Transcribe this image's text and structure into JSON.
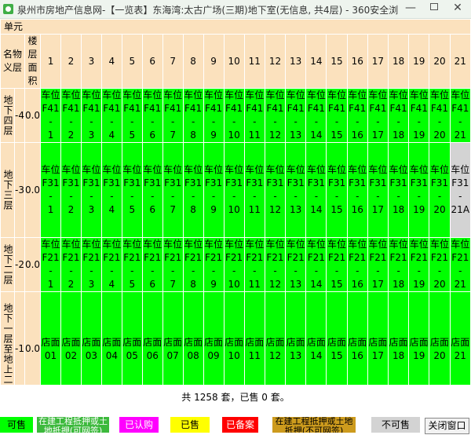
{
  "window": {
    "title": "泉州市房地产信息网-【一览表】东海湾:太古广场(三期)地下室(无信息, 共4层) - 360安全浏",
    "minimize": "—",
    "close": "✕"
  },
  "table": {
    "unit_label": "单元",
    "name_header": "名物义层",
    "area_header": "楼层面积",
    "columns": [
      "1",
      "2",
      "3",
      "4",
      "5",
      "6",
      "7",
      "8",
      "9",
      "10",
      "11",
      "12",
      "13",
      "14",
      "15",
      "16",
      "17",
      "18",
      "19",
      "20",
      "21"
    ],
    "floors": [
      {
        "name": "地下四层",
        "floor": "-4",
        "area": "0.0",
        "cells": [
          {
            "prefix": "车位",
            "code": "F41-",
            "num": "1"
          },
          {
            "prefix": "车位",
            "code": "F41-",
            "num": "2"
          },
          {
            "prefix": "车位",
            "code": "F41-",
            "num": "3"
          },
          {
            "prefix": "车位",
            "code": "F41-",
            "num": "4"
          },
          {
            "prefix": "车位",
            "code": "F41-",
            "num": "5"
          },
          {
            "prefix": "车位",
            "code": "F41-",
            "num": "6"
          },
          {
            "prefix": "车位",
            "code": "F41-",
            "num": "7"
          },
          {
            "prefix": "车位",
            "code": "F41-",
            "num": "8"
          },
          {
            "prefix": "车位",
            "code": "F41-",
            "num": "9"
          },
          {
            "prefix": "车位",
            "code": "F41-",
            "num": "10"
          },
          {
            "prefix": "车位",
            "code": "F41-",
            "num": "11"
          },
          {
            "prefix": "车位",
            "code": "F41-",
            "num": "12"
          },
          {
            "prefix": "车位",
            "code": "F41-",
            "num": "13"
          },
          {
            "prefix": "车位",
            "code": "F41-",
            "num": "14"
          },
          {
            "prefix": "车位",
            "code": "F41-",
            "num": "15"
          },
          {
            "prefix": "车位",
            "code": "F41-",
            "num": "16"
          },
          {
            "prefix": "车位",
            "code": "F41-",
            "num": "17"
          },
          {
            "prefix": "车位",
            "code": "F41-",
            "num": "18"
          },
          {
            "prefix": "车位",
            "code": "F41-",
            "num": "19"
          },
          {
            "prefix": "车位",
            "code": "F41-",
            "num": "20"
          },
          {
            "prefix": "车位",
            "code": "F41-",
            "num": "21"
          }
        ]
      },
      {
        "name": "地下三层",
        "floor": "-3",
        "area": "0.0",
        "cells": [
          {
            "prefix": "车位",
            "code": "F31-",
            "num": "1"
          },
          {
            "prefix": "车位",
            "code": "F31-",
            "num": "2"
          },
          {
            "prefix": "车位",
            "code": "F31-",
            "num": "3"
          },
          {
            "prefix": "车位",
            "code": "F31-",
            "num": "4"
          },
          {
            "prefix": "车位",
            "code": "F31-",
            "num": "5"
          },
          {
            "prefix": "车位",
            "code": "F31-",
            "num": "6"
          },
          {
            "prefix": "车位",
            "code": "F31-",
            "num": "7"
          },
          {
            "prefix": "车位",
            "code": "F31-",
            "num": "8"
          },
          {
            "prefix": "车位",
            "code": "F31-",
            "num": "9"
          },
          {
            "prefix": "车位",
            "code": "F31-",
            "num": "10"
          },
          {
            "prefix": "车位",
            "code": "F31-",
            "num": "11"
          },
          {
            "prefix": "车位",
            "code": "F31-",
            "num": "12"
          },
          {
            "prefix": "车位",
            "code": "F31-",
            "num": "13"
          },
          {
            "prefix": "车位",
            "code": "F31-",
            "num": "14"
          },
          {
            "prefix": "车位",
            "code": "F31-",
            "num": "15"
          },
          {
            "prefix": "车位",
            "code": "F31-",
            "num": "16"
          },
          {
            "prefix": "车位",
            "code": "F31-",
            "num": "17"
          },
          {
            "prefix": "车位",
            "code": "F31-",
            "num": "18"
          },
          {
            "prefix": "车位",
            "code": "F31-",
            "num": "19"
          },
          {
            "prefix": "车位",
            "code": "F31-",
            "num": "20"
          },
          {
            "prefix": "车位",
            "code": "F31-",
            "num": "21A",
            "gray": true
          }
        ]
      },
      {
        "name": "地下二层",
        "floor": "-2",
        "area": "0.0",
        "cells": [
          {
            "prefix": "车位",
            "code": "F21-",
            "num": "1"
          },
          {
            "prefix": "车位",
            "code": "F21-",
            "num": "2"
          },
          {
            "prefix": "车位",
            "code": "F21-",
            "num": "3"
          },
          {
            "prefix": "车位",
            "code": "F21-",
            "num": "4"
          },
          {
            "prefix": "车位",
            "code": "F21-",
            "num": "5"
          },
          {
            "prefix": "车位",
            "code": "F21-",
            "num": "6"
          },
          {
            "prefix": "车位",
            "code": "F21-",
            "num": "7"
          },
          {
            "prefix": "车位",
            "code": "F21-",
            "num": "8"
          },
          {
            "prefix": "车位",
            "code": "F21-",
            "num": "9"
          },
          {
            "prefix": "车位",
            "code": "F21-",
            "num": "10"
          },
          {
            "prefix": "车位",
            "code": "F21-",
            "num": "11"
          },
          {
            "prefix": "车位",
            "code": "F21-",
            "num": "12"
          },
          {
            "prefix": "车位",
            "code": "F21-",
            "num": "13"
          },
          {
            "prefix": "车位",
            "code": "F21-",
            "num": "14"
          },
          {
            "prefix": "车位",
            "code": "F21-",
            "num": "15"
          },
          {
            "prefix": "车位",
            "code": "F21-",
            "num": "16"
          },
          {
            "prefix": "车位",
            "code": "F21-",
            "num": "17"
          },
          {
            "prefix": "车位",
            "code": "F21-",
            "num": "18"
          },
          {
            "prefix": "车位",
            "code": "F21-",
            "num": "19"
          },
          {
            "prefix": "车位",
            "code": "F21-",
            "num": "20"
          },
          {
            "prefix": "车位",
            "code": "F21-",
            "num": "21"
          }
        ]
      },
      {
        "name": "地下一层至地上二层",
        "floor": "-1",
        "area": "0.0",
        "cells": [
          {
            "prefix": "店面",
            "code": "",
            "num": "01"
          },
          {
            "prefix": "店面",
            "code": "",
            "num": "02"
          },
          {
            "prefix": "店面",
            "code": "",
            "num": "03"
          },
          {
            "prefix": "店面",
            "code": "",
            "num": "04"
          },
          {
            "prefix": "店面",
            "code": "",
            "num": "05"
          },
          {
            "prefix": "店面",
            "code": "",
            "num": "06"
          },
          {
            "prefix": "店面",
            "code": "",
            "num": "07"
          },
          {
            "prefix": "店面",
            "code": "",
            "num": "08"
          },
          {
            "prefix": "店面",
            "code": "",
            "num": "09"
          },
          {
            "prefix": "店面",
            "code": "",
            "num": "10"
          },
          {
            "prefix": "店面",
            "code": "",
            "num": "11"
          },
          {
            "prefix": "店面",
            "code": "",
            "num": "12"
          },
          {
            "prefix": "店面",
            "code": "",
            "num": "13"
          },
          {
            "prefix": "店面",
            "code": "",
            "num": "14"
          },
          {
            "prefix": "店面",
            "code": "",
            "num": "15"
          },
          {
            "prefix": "店面",
            "code": "",
            "num": "16"
          },
          {
            "prefix": "店面",
            "code": "",
            "num": "17"
          },
          {
            "prefix": "店面",
            "code": "",
            "num": "18"
          },
          {
            "prefix": "店面",
            "code": "",
            "num": "19"
          },
          {
            "prefix": "店面",
            "code": "",
            "num": "20"
          },
          {
            "prefix": "店面",
            "code": "",
            "num": "21"
          }
        ]
      }
    ]
  },
  "summary": "共 1258 套，已售 0 套。",
  "legend": [
    {
      "label": "可售",
      "bg": "#00ff00",
      "color": "#000000"
    },
    {
      "label": "在建工程抵押或土地抵押(可网签)",
      "bg": "#3cb93c",
      "color": "#ffffff"
    },
    {
      "label": "已认购",
      "bg": "#ff00ff",
      "color": "#ffffff"
    },
    {
      "label": "已售",
      "bg": "#ffff00",
      "color": "#000000"
    },
    {
      "label": "已备案",
      "bg": "#ff0000",
      "color": "#ffffff"
    },
    {
      "label": "在建工程抵押或土地抵押(不可网签)",
      "bg": "#cd9b1d",
      "color": "#000000"
    },
    {
      "label": "不可售",
      "bg": "#d3d3d3",
      "color": "#000000"
    }
  ],
  "close_button": "关闭窗口"
}
